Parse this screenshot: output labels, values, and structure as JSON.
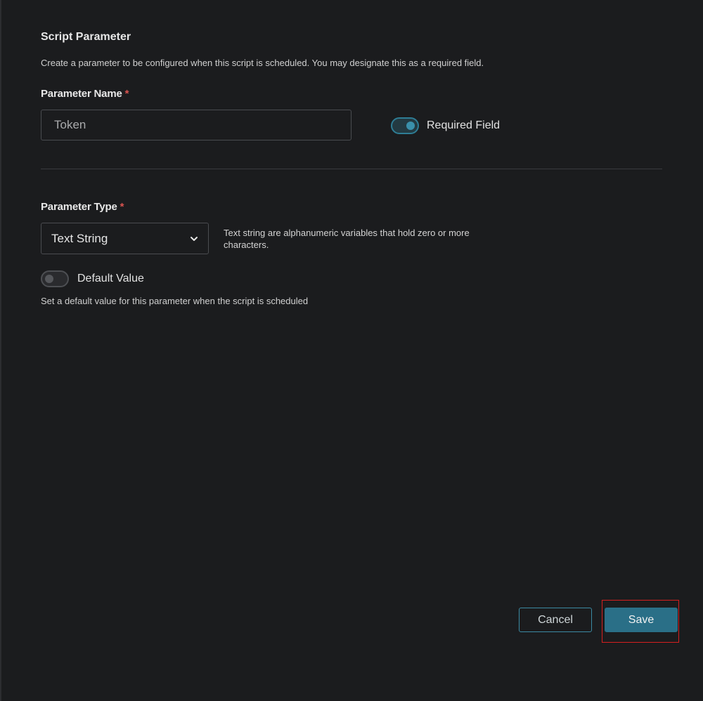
{
  "section": {
    "title": "Script Parameter",
    "description": "Create a parameter to be configured when this script is scheduled. You may designate this as a required field."
  },
  "parameter_name": {
    "label": "Parameter Name",
    "required_marker": "*",
    "value": "Token"
  },
  "required_field": {
    "label": "Required Field",
    "checked": true
  },
  "parameter_type": {
    "label": "Parameter Type",
    "required_marker": "*",
    "selected": "Text String",
    "help": "Text string are alphanumeric variables that hold zero or more characters."
  },
  "default_value": {
    "label": "Default Value",
    "checked": false,
    "help": "Set a default value for this parameter when the script is scheduled"
  },
  "actions": {
    "cancel_label": "Cancel",
    "save_label": "Save"
  },
  "colors": {
    "accent": "#2a6f87",
    "required": "#d9534f",
    "highlight": "#d61f1f"
  }
}
